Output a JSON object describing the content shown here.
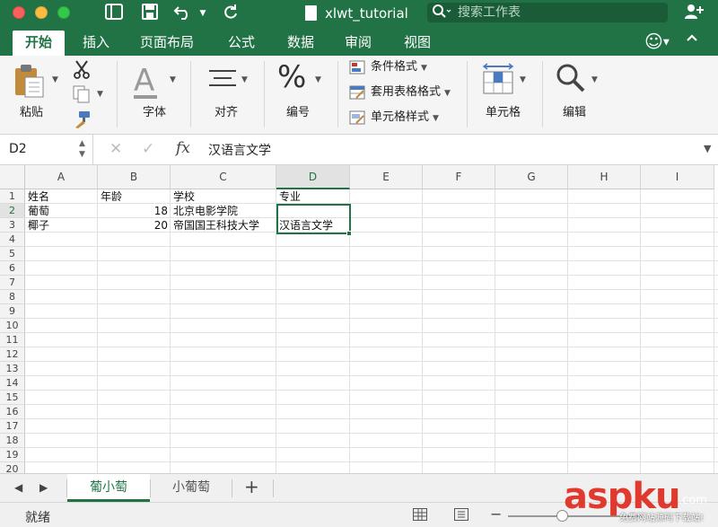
{
  "window": {
    "title": "xlwt_tutorial",
    "search_placeholder": "搜索工作表"
  },
  "ribbon_tabs": [
    "开始",
    "插入",
    "页面布局",
    "公式",
    "数据",
    "审阅",
    "视图"
  ],
  "ribbon": {
    "paste": "粘贴",
    "font": "字体",
    "align": "对齐",
    "number": "编号",
    "conditional_format": "条件格式",
    "table_format": "套用表格格式",
    "cell_style": "单元格样式",
    "cells": "单元格",
    "edit": "编辑"
  },
  "formula_bar": {
    "name_box": "D2",
    "fx_label": "fx",
    "content": "汉语言文学"
  },
  "columns": [
    "A",
    "B",
    "C",
    "D",
    "E",
    "F",
    "G",
    "H",
    "I"
  ],
  "rows": [
    "1",
    "2",
    "3",
    "4",
    "5",
    "6",
    "7",
    "8",
    "9",
    "10",
    "11",
    "12",
    "13",
    "14",
    "15",
    "16",
    "17",
    "18",
    "19",
    "20"
  ],
  "cells": {
    "A1": "姓名",
    "B1": "年龄",
    "C1": "学校",
    "D1": "专业",
    "A2": "葡萄",
    "B2": "18",
    "C2": "北京电影学院",
    "A3": "椰子",
    "B3": "20",
    "C3": "帝国国王科技大学",
    "D3": "汉语言文学"
  },
  "sheets": [
    "葡小萄",
    "小葡萄"
  ],
  "active_sheet": "葡小萄",
  "status": "就绪",
  "watermark": {
    "brand": "aspku",
    "suffix": ".com",
    "tagline": "免费网站源码下载站!"
  },
  "colors": {
    "accent": "#217346",
    "watermark": "#e03a2e"
  }
}
